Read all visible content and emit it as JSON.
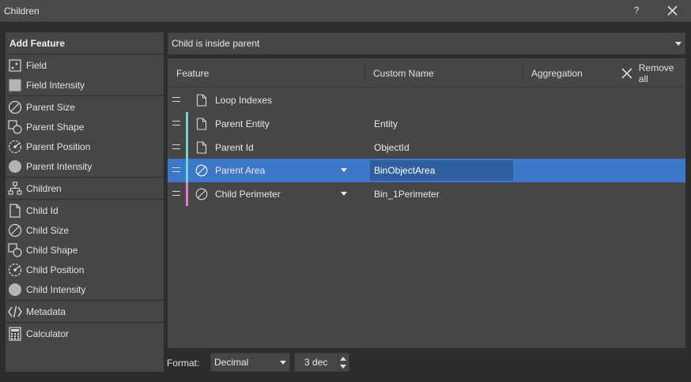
{
  "window": {
    "title": "Children",
    "help_label": "?"
  },
  "sidebar": {
    "header": "Add Feature",
    "groups": [
      {
        "items": [
          {
            "label": "Field",
            "icon": "field-icon"
          },
          {
            "label": "Field Intensity",
            "icon": "field-intensity-icon"
          }
        ]
      },
      {
        "items": [
          {
            "label": "Parent Size",
            "icon": "size-icon"
          },
          {
            "label": "Parent Shape",
            "icon": "shape-icon"
          },
          {
            "label": "Parent Position",
            "icon": "position-icon"
          },
          {
            "label": "Parent Intensity",
            "icon": "intensity-icon"
          }
        ]
      },
      {
        "items": [
          {
            "label": "Children",
            "icon": "hierarchy-icon"
          }
        ]
      },
      {
        "items": [
          {
            "label": "Child Id",
            "icon": "document-icon"
          },
          {
            "label": "Child Size",
            "icon": "size-icon"
          },
          {
            "label": "Child Shape",
            "icon": "shape-icon"
          },
          {
            "label": "Child Position",
            "icon": "position-icon"
          },
          {
            "label": "Child Intensity",
            "icon": "intensity-icon"
          }
        ]
      },
      {
        "items": [
          {
            "label": "Metadata",
            "icon": "code-icon"
          }
        ]
      },
      {
        "items": [
          {
            "label": "Calculator",
            "icon": "calculator-icon"
          }
        ]
      }
    ]
  },
  "filter": {
    "value": "Child is inside parent"
  },
  "table": {
    "headers": {
      "feature": "Feature",
      "custom_name": "Custom Name",
      "aggregation": "Aggregation",
      "remove_all": "Remove all"
    },
    "rows": [
      {
        "feature": "Loop Indexes",
        "custom_name": "",
        "icon": "document-icon",
        "color": "",
        "has_dropdown": false,
        "selected": false
      },
      {
        "feature": "Parent Entity",
        "custom_name": "Entity",
        "icon": "document-icon",
        "color": "#6fd6d0",
        "has_dropdown": false,
        "selected": false
      },
      {
        "feature": "Parent Id",
        "custom_name": "ObjectId",
        "icon": "document-icon",
        "color": "#6fd6d0",
        "has_dropdown": false,
        "selected": false
      },
      {
        "feature": "Parent Area",
        "custom_name": "BinObjectArea",
        "icon": "size-icon",
        "color": "#6fd6d0",
        "has_dropdown": true,
        "selected": true
      },
      {
        "feature": "Child Perimeter",
        "custom_name": "Bin_1Perimeter",
        "icon": "size-icon",
        "color": "#e07ed0",
        "has_dropdown": true,
        "selected": false
      }
    ]
  },
  "footer": {
    "format_label": "Format:",
    "format_value": "Decimal",
    "decimals_value": "3 dec"
  },
  "colors": {
    "selection": "#3d77c8",
    "edit_field": "#2f5f9e",
    "parent_marker": "#6fd6d0",
    "child_marker": "#e07ed0"
  }
}
